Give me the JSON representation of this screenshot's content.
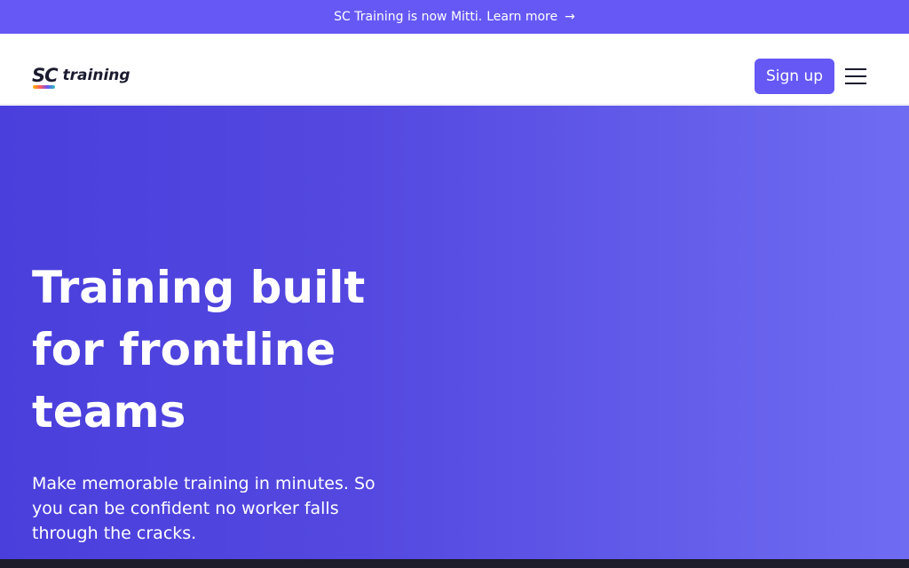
{
  "announcement": {
    "text": "SC Training is now Mitti.",
    "link_label": "Learn more",
    "arrow": "→"
  },
  "nav": {
    "logo_mark": "SC",
    "logo_word": "training",
    "signup_label": "Sign up",
    "menu_icon": "hamburger-menu-icon"
  },
  "hero": {
    "headline": "Training built for frontline teams",
    "subheadline": "Make memorable training in minutes. So you can be confident no worker falls through the cracks."
  },
  "colors": {
    "brand": "#6558f5",
    "hero_start": "#4a3fdc",
    "hero_end": "#6f6cf2",
    "text_dark": "#1b1b2f"
  }
}
